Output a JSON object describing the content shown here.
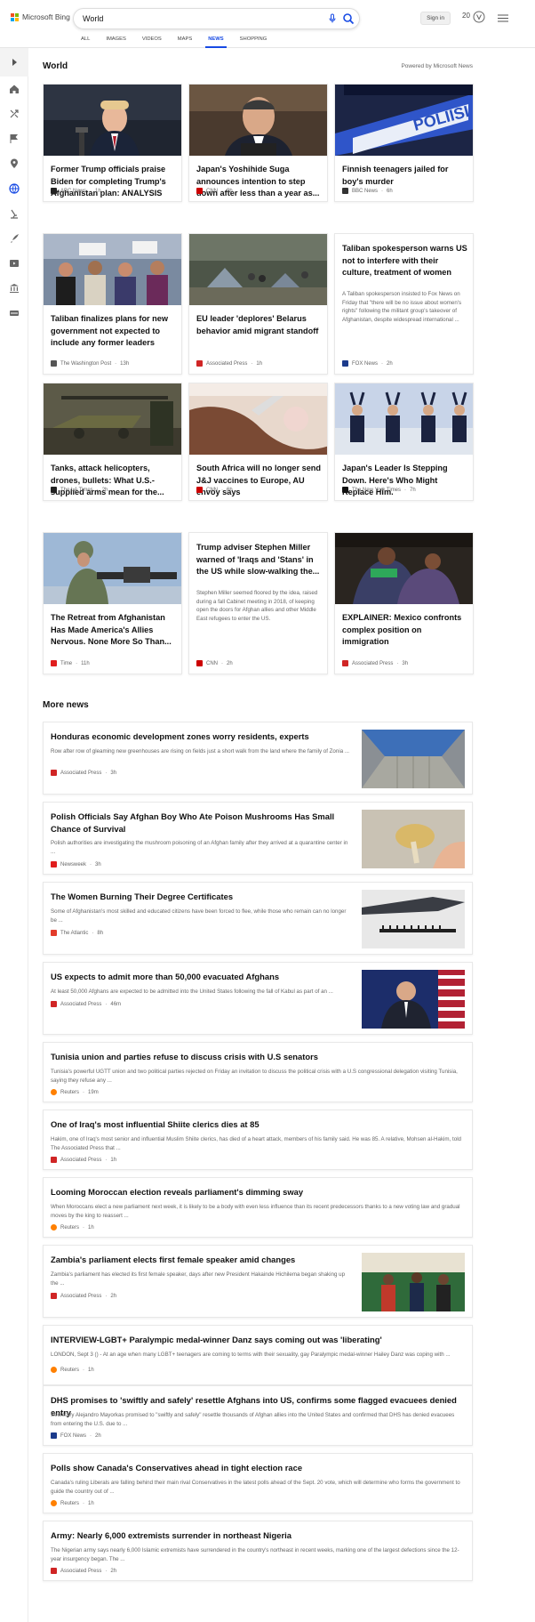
{
  "header": {
    "brand": "Microsoft Bing",
    "search_value": "World",
    "signin_label": "Sign in",
    "rewards_count": "20",
    "scopes": [
      "ALL",
      "IMAGES",
      "VIDEOS",
      "MAPS",
      "NEWS",
      "SHOPPING"
    ],
    "active_scope": "NEWS"
  },
  "colors": {
    "accent": "#174ae4",
    "cnn": "#cc0000",
    "ap": "#d02525"
  },
  "sidebar": {
    "icons": [
      "expand-icon",
      "home-icon",
      "trending-icon",
      "flag-icon",
      "location-icon",
      "globe-icon",
      "science-icon",
      "rocket-icon",
      "entertainment-icon",
      "government-icon",
      "money-icon"
    ]
  },
  "section": {
    "title": "World",
    "powered": "Powered by Microsoft News"
  },
  "cards": [
    {
      "title": "Former Trump officials praise Biden for completing Trump's Afghanistan plan: ANALYSIS",
      "source": "ABC News",
      "age": "1h"
    },
    {
      "title": "Japan's Yoshihide Suga announces intention to step down after less than a year as...",
      "source": "CNN",
      "age": "9h"
    },
    {
      "title": "Finnish teenagers jailed for boy's murder",
      "source": "BBC News",
      "age": "6h"
    },
    {
      "title": "Taliban finalizes plans for new government not expected to include any former leaders",
      "source": "The Washington Post",
      "age": "13h"
    },
    {
      "title": "EU leader 'deplores' Belarus behavior amid migrant standoff",
      "source": "Associated Press",
      "age": "1h"
    },
    {
      "title": "Taliban spokesperson warns US not to interfere with their culture, treatment of women",
      "snippet": "A Taliban spokesperson insisted to Fox News on Friday that \"there will be no issue about women's rights\" following the militant group's takeover of Afghanistan, despite widespread international ...",
      "source": "FOX News",
      "age": "2h"
    },
    {
      "title": "Tanks, attack helicopters, drones, bullets: What U.S.-supplied arms mean for the...",
      "source": "The LA Times",
      "age": "2h"
    },
    {
      "title": "South Africa will no longer send J&J vaccines to Europe, AU envoy says",
      "source": "CNN",
      "age": "6h"
    },
    {
      "title": "Japan's Leader Is Stepping Down. Here's Who Might Replace Him.",
      "source": "The New York Times",
      "age": "7h"
    },
    {
      "title": "The Retreat from Afghanistan Has Made America's Allies Nervous. None More So Than...",
      "source": "Time",
      "age": "11h"
    },
    {
      "title": "Trump adviser Stephen Miller warned of 'Iraqs and 'Stans' in the US while slow-walking the...",
      "snippet": "Stephen Miller seemed floored by the idea, raised during a fall Cabinet meeting in 2018, of keeping open the doors for Afghan allies and other Middle East refugees to enter the US.",
      "source": "CNN",
      "age": "2h"
    },
    {
      "title": "EXPLAINER: Mexico confronts complex position on immigration",
      "source": "Associated Press",
      "age": "3h"
    }
  ],
  "more": {
    "title": "More news",
    "items": [
      {
        "title": "Honduras economic development zones worry residents, experts",
        "snippet": "Row after row of gleaming new greenhouses are rising on fields just a short walk from the land where the family of Zonia ...",
        "source": "Associated Press",
        "age": "3h"
      },
      {
        "title": "Polish Officials Say Afghan Boy Who Ate Poison Mushrooms Has Small Chance of Survival",
        "snippet": "Polish authorities are investigating the mushroom poisoning of an Afghan family after they arrived at a quarantine center in ...",
        "source": "Newsweek",
        "age": "3h"
      },
      {
        "title": "The Women Burning Their Degree Certificates",
        "snippet": "Some of Afghanistan's most skilled and educated citizens have been forced to flee, while those who remain can no longer be ...",
        "source": "The Atlantic",
        "age": "8h"
      },
      {
        "title": "US expects to admit more than 50,000 evacuated Afghans",
        "snippet": "At least 50,000 Afghans are expected to be admitted into the United States following the fall of Kabul as part of an ...",
        "source": "Associated Press",
        "age": "46m"
      },
      {
        "title": "Tunisia union and parties refuse to discuss crisis with U.S senators",
        "snippet": "Tunisia's powerful UGTT union and two political parties rejected on Friday an invitation to discuss the political crisis with a U.S congressional delegation visiting Tunisia, saying they refuse any ...",
        "source": "Reuters",
        "age": "19m"
      },
      {
        "title": "One of Iraq's most influential Shiite clerics dies at 85",
        "snippet": "Hakim, one of Iraq's most senior and influential Muslim Shiite clerics, has died of a heart attack, members of his family said. He was 85. A relative, Mohsen al-Hakim, told The Associated Press that ...",
        "source": "Associated Press",
        "age": "1h"
      },
      {
        "title": "Looming Moroccan election reveals parliament's dimming sway",
        "snippet": "When Moroccans elect a new parliament next week, it is likely to be a body with even less influence than its recent predecessors thanks to a new voting law and gradual moves by the king to reassert ...",
        "source": "Reuters",
        "age": "1h"
      },
      {
        "title": "Zambia's parliament elects first female speaker amid changes",
        "snippet": "Zambia's parliament has elected its first female speaker, days after new President Hakainde Hichilema began shaking up the ...",
        "source": "Associated Press",
        "age": "2h"
      },
      {
        "title": "INTERVIEW-LGBT+ Paralympic medal-winner Danz says coming out was 'liberating'",
        "snippet": "LONDON, Sept 3 () - At an age when many LGBT+ teenagers are coming to terms with their sexuality, gay Paralympic medal-winner Hailey Danz was coping with ...",
        "source": "Reuters",
        "age": "1h"
      },
      {
        "title": "DHS promises to 'swiftly and safely' resettle Afghans into US, confirms some flagged evacuees denied entry",
        "snippet": "Secretary Alejandro Mayorkas promised to \"swiftly and safely\" resettle thousands of Afghan allies into the United States and confirmed that DHS has denied evacuees from entering the U.S. due to ...",
        "source": "FOX News",
        "age": "2h"
      },
      {
        "title": "Polls show Canada's Conservatives ahead in tight election race",
        "snippet": "Canada's ruling Liberals are falling behind their main rival Conservatives in the latest polls ahead of the Sept. 20 vote, which will determine who forms the government to guide the country out of ...",
        "source": "Reuters",
        "age": "1h"
      },
      {
        "title": "Army: Nearly 6,000 extremists surrender in northeast Nigeria",
        "snippet": "The Nigerian army says nearly 6,000 Islamic extremists have surrendered in the country's northeast in recent weeks, marking one of the largest defections since the 12-year insurgency began. The ...",
        "source": "Associated Press",
        "age": "2h"
      }
    ]
  }
}
